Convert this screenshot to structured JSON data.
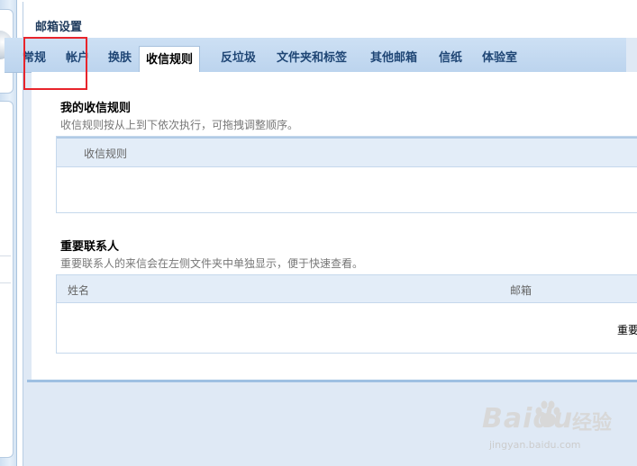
{
  "window": {
    "title": "邮箱设置"
  },
  "tabs": [
    {
      "label": "常规",
      "active": false
    },
    {
      "label": "帐户",
      "active": false
    },
    {
      "label": "换肤",
      "active": false
    },
    {
      "label": "收信规则",
      "active": true
    },
    {
      "label": "反垃圾",
      "active": false
    },
    {
      "label": "文件夹和标签",
      "active": false
    },
    {
      "label": "其他邮箱",
      "active": false
    },
    {
      "label": "信纸",
      "active": false
    },
    {
      "label": "体验室",
      "active": false
    }
  ],
  "rules_section": {
    "title": "我的收信规则",
    "description": "收信规则按从上到下依次执行，可拖拽调整顺序。",
    "column_header": "收信规则"
  },
  "contacts_section": {
    "title": "重要联系人",
    "description": "重要联系人的来信会在左侧文件夹中单独显示，便于快速查看。",
    "columns": [
      "姓名",
      "邮箱"
    ],
    "empty_text": "重要"
  },
  "watermark": {
    "brand": "Baidu",
    "cn": "经验",
    "url": "jingyan.baidu.com"
  },
  "colors": {
    "highlight": "#e8242b",
    "tabbar": "#c5dbf1",
    "link": "#1f4675"
  }
}
